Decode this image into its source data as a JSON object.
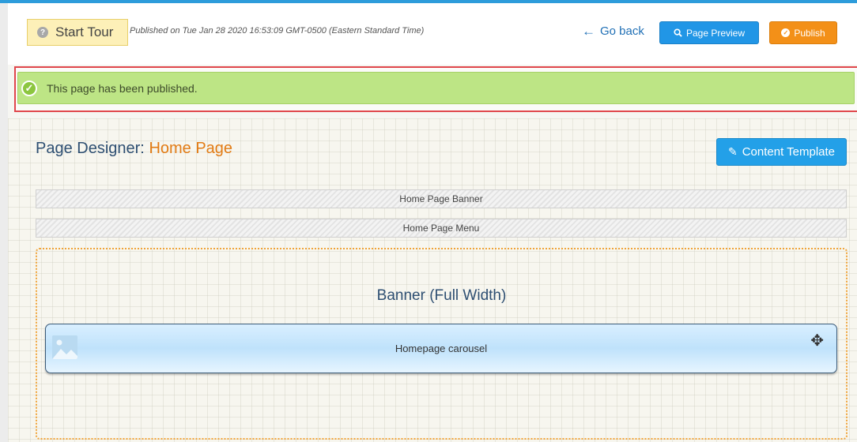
{
  "header": {
    "start_tour_label": "Start Tour",
    "published_info": "Published on Tue Jan 28 2020 16:53:09 GMT-0500 (Eastern Standard Time)",
    "go_back_label": "Go back",
    "page_preview_label": "Page Preview",
    "publish_label": "Publish"
  },
  "notice": {
    "message": "This page has been published."
  },
  "designer": {
    "title_prefix": "Page Designer:",
    "page_name": "Home Page",
    "content_template_label": "Content Template",
    "banner_bar_label": "Home Page Banner",
    "menu_bar_label": "Home Page Menu",
    "region_title": "Banner (Full Width)",
    "widget_label": "Homepage carousel"
  },
  "colors": {
    "accent_blue": "#2196e6",
    "publish_orange": "#f39018",
    "success_green": "#bde585",
    "title_blue": "#2e4f72",
    "title_orange": "#e27b14"
  },
  "icons": [
    "question-icon",
    "arrow-left-icon",
    "search-icon",
    "check-circle-icon",
    "pencil-icon",
    "image-icon",
    "move-icon"
  ]
}
